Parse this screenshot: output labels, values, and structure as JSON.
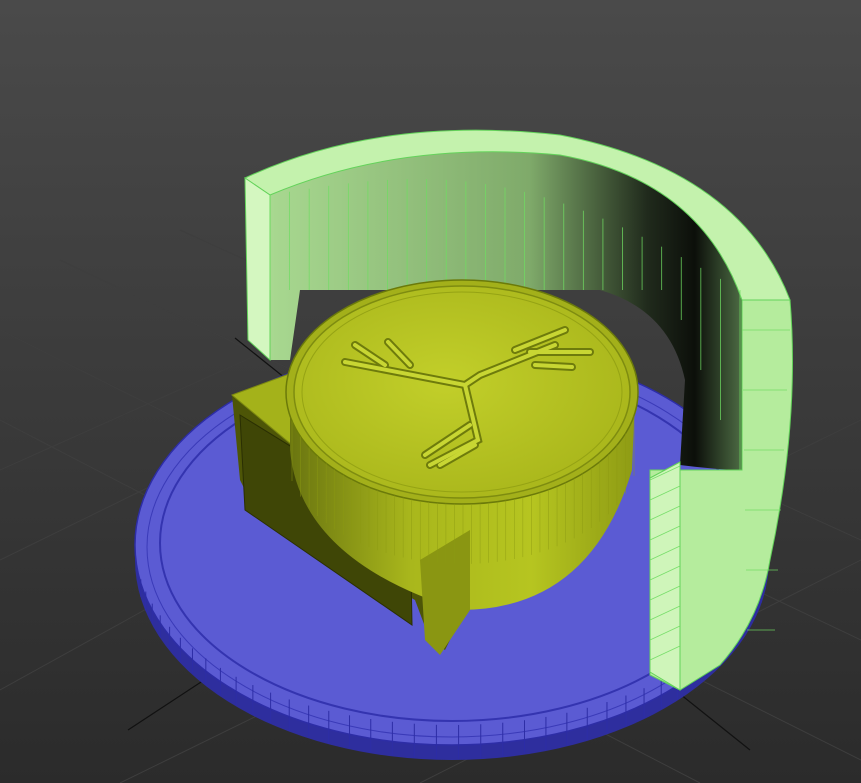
{
  "viewport": {
    "active_border_color": "#b8943c",
    "background_top": "#4a4a4a",
    "background_bottom": "#2b2b2b"
  },
  "scene": {
    "objects": [
      {
        "name": "base-disc",
        "color": "#5b5bd3",
        "wire_color": "#2d2da6"
      },
      {
        "name": "curved-wall",
        "color": "#b4ef9c",
        "wire_color": "#63d35a",
        "selected": true
      },
      {
        "name": "coin-holder",
        "color": "#aebf18",
        "wire_color": "#6b7a0a"
      },
      {
        "name": "coin-emblem",
        "icon": "tree-emblem-icon"
      }
    ]
  }
}
